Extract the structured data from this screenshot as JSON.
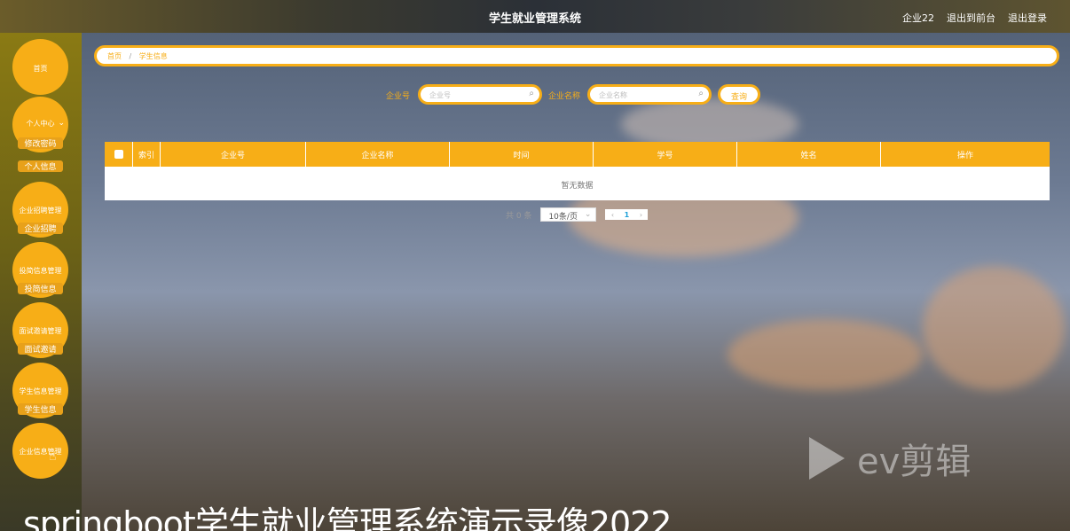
{
  "header": {
    "title": "学生就业管理系统",
    "user": "企业22",
    "front_link": "退出到前台",
    "logout": "退出登录"
  },
  "sidebar": {
    "home": "首页",
    "personal": "个人中心",
    "personal_items": [
      "修改密码",
      "个人信息"
    ],
    "groups": [
      {
        "label": "企业招聘管理",
        "item": "企业招聘"
      },
      {
        "label": "投简信息管理",
        "item": "投简信息"
      },
      {
        "label": "面试邀请管理",
        "item": "面试邀请"
      },
      {
        "label": "学生信息管理",
        "item": "学生信息"
      },
      {
        "label": "企业信息管理",
        "item": ""
      }
    ]
  },
  "breadcrumb": {
    "home": "首页",
    "sep": "/",
    "current": "学生信息"
  },
  "search": {
    "field1_label": "企业号",
    "field1_placeholder": "企业号",
    "field2_label": "企业名称",
    "field2_placeholder": "企业名称",
    "query_button": "查询"
  },
  "table": {
    "columns": [
      "索引",
      "企业号",
      "企业名称",
      "时间",
      "学号",
      "姓名",
      "操作"
    ],
    "empty_text": "暂无数据"
  },
  "pagination": {
    "total": "共 0 条",
    "page_size": "10条/页",
    "current_page": "1"
  },
  "overlay": {
    "watermark": "ev剪辑",
    "caption": "springboot学生就业管理系统演示录像2022"
  },
  "colors": {
    "accent": "#f7ae17"
  }
}
